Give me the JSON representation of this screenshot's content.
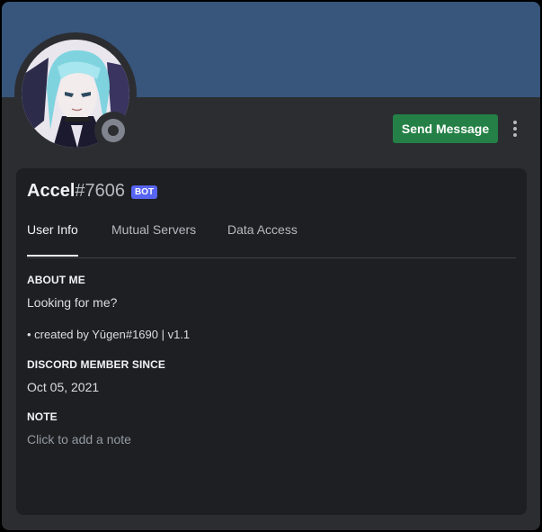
{
  "header": {
    "send_message_label": "Send Message",
    "more_icon": "vertical-ellipsis-icon",
    "banner_color": "#38557b",
    "status": "offline"
  },
  "profile": {
    "username": "Accel",
    "discriminator": "#7606",
    "bot_tag": "BOT"
  },
  "tabs": [
    {
      "label": "User Info",
      "active": true
    },
    {
      "label": "Mutual Servers",
      "active": false
    },
    {
      "label": "Data Access",
      "active": false
    }
  ],
  "about_me": {
    "title": "ABOUT ME",
    "line1": "Looking for me?",
    "line2": "• created by Yūgen#1690 | v1.1"
  },
  "member_since": {
    "title": "DISCORD MEMBER SINCE",
    "date": "Oct 05, 2021"
  },
  "note": {
    "title": "NOTE",
    "placeholder": "Click to add a note"
  },
  "colors": {
    "button_green": "#248046",
    "bot_tag_blurple": "#5865f2",
    "modal_bg": "#2b2d31",
    "panel_bg": "#1e1f22"
  }
}
